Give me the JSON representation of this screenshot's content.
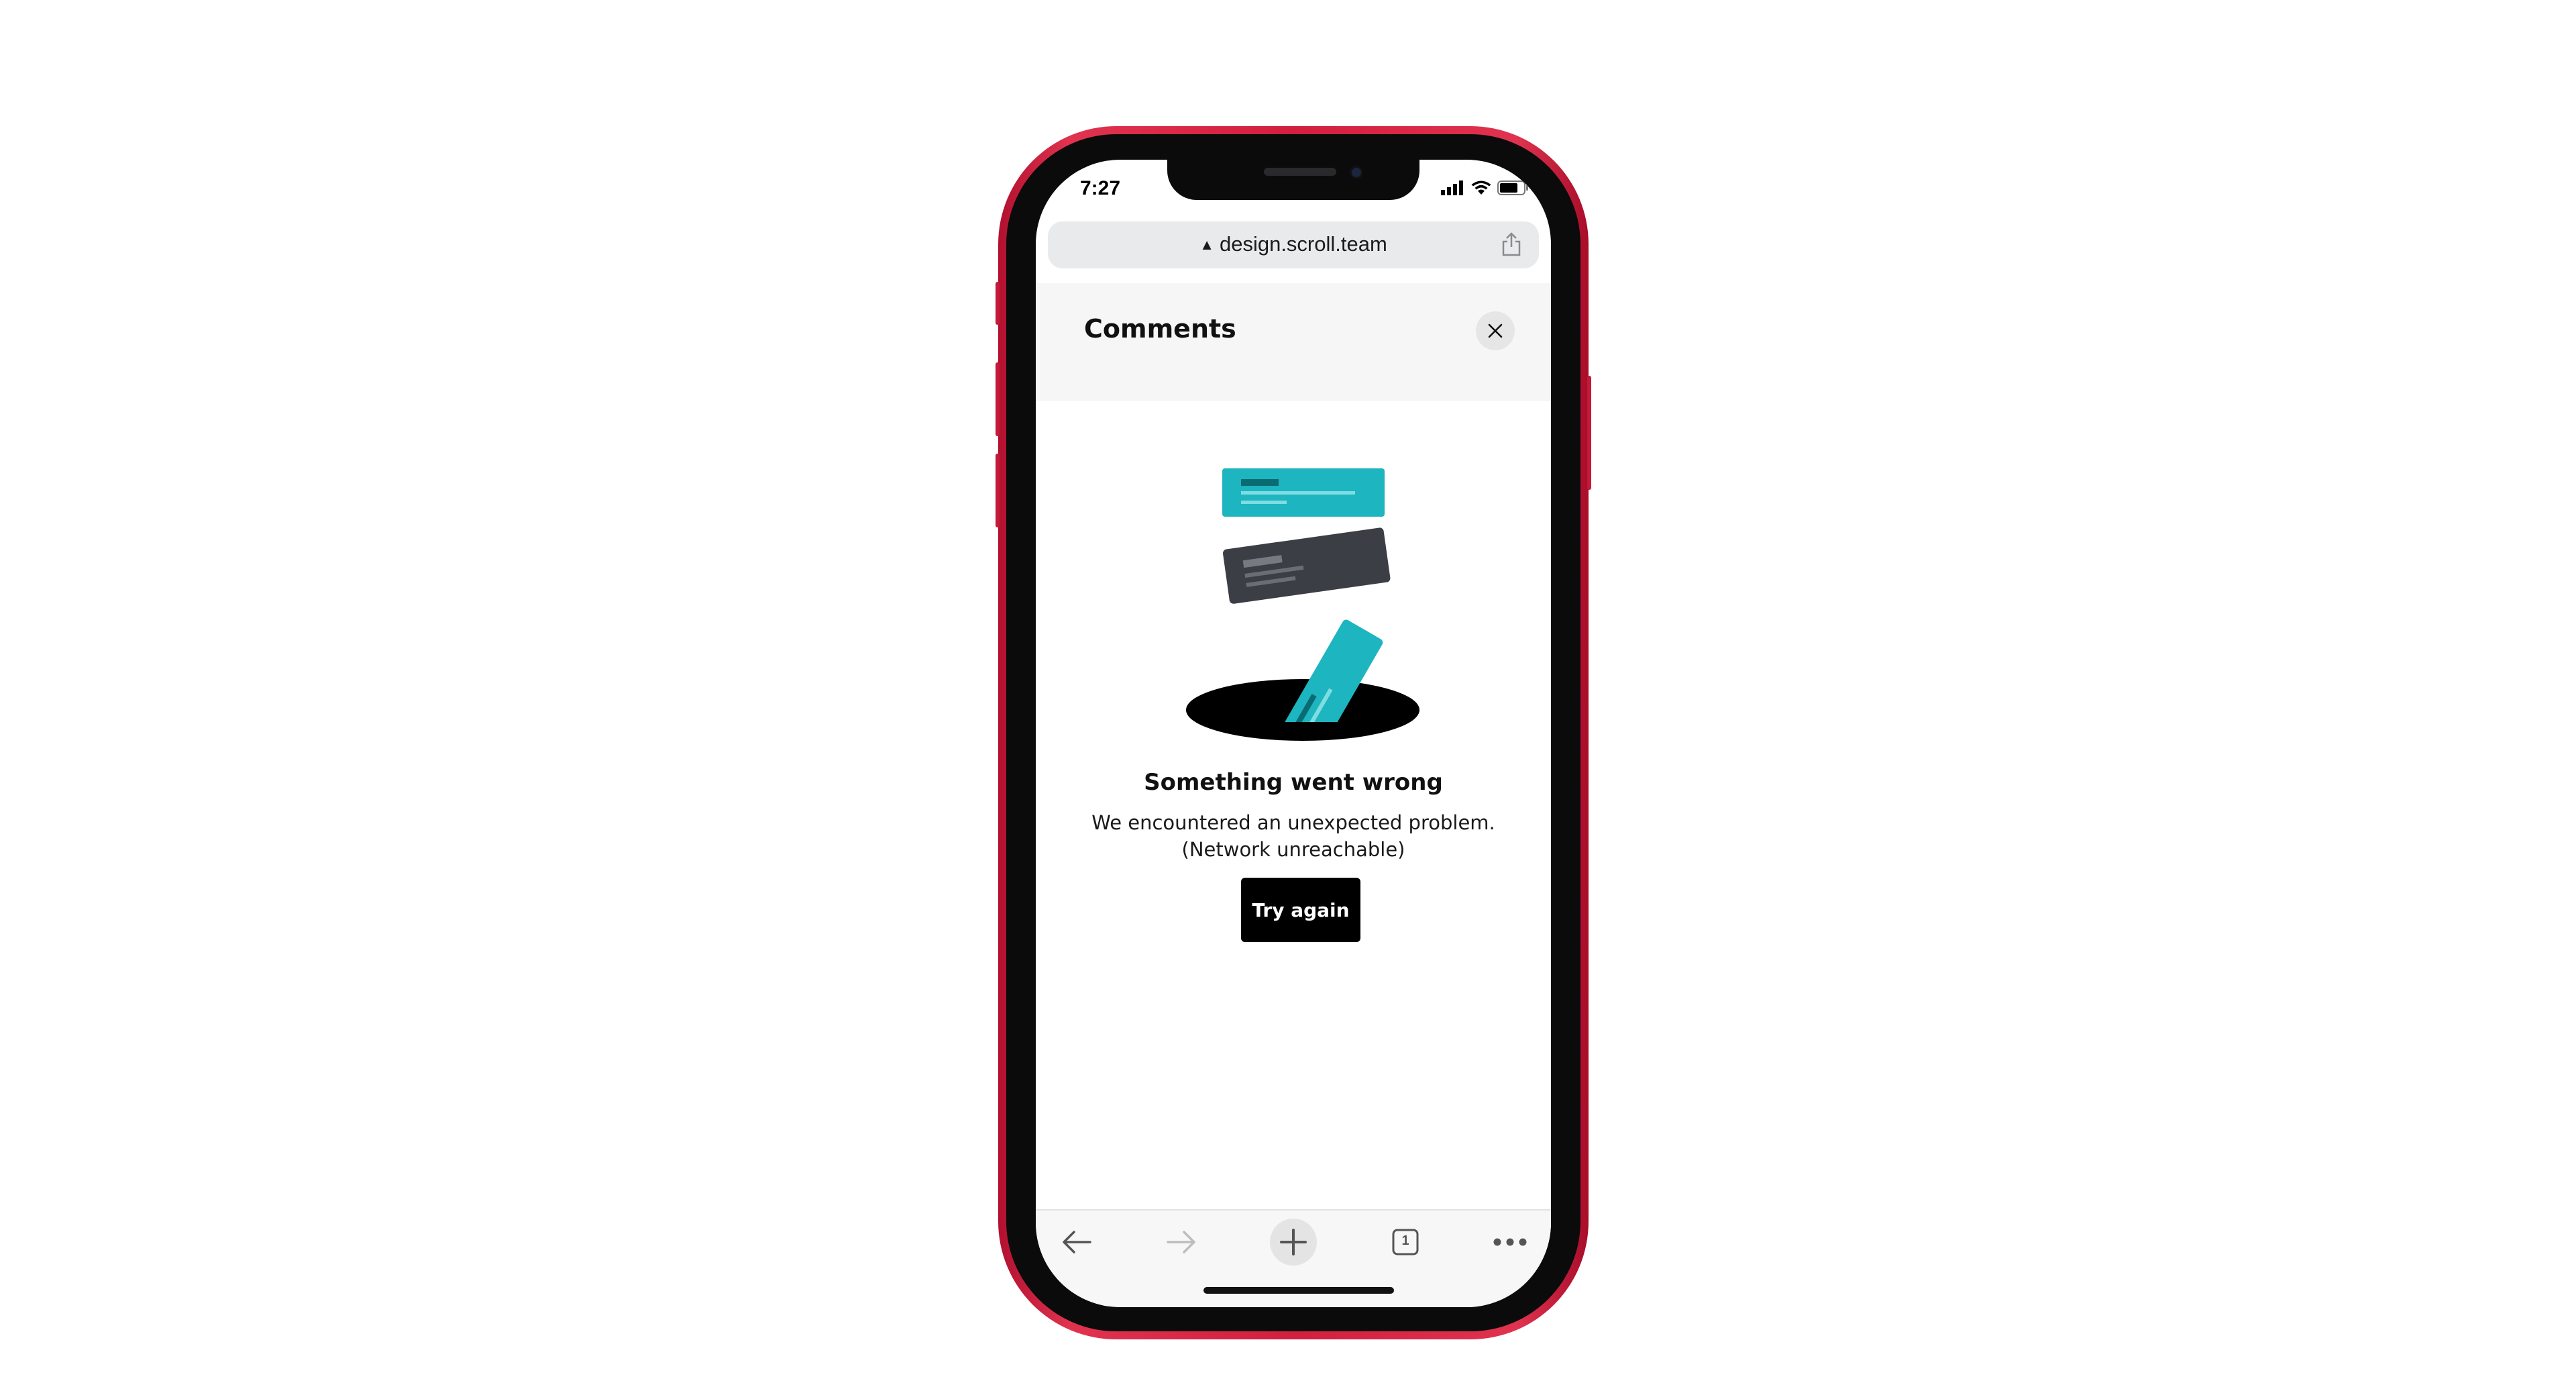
{
  "status_bar": {
    "time": "7:27"
  },
  "browser": {
    "url": "design.scroll.team",
    "lock_glyph": "▲"
  },
  "panel": {
    "title": "Comments",
    "close_icon": "close-icon"
  },
  "error": {
    "title": "Something went wrong",
    "message_line1": "We encountered an unexpected problem.",
    "message_line2": "(Network unreachable)",
    "retry_label": "Try again"
  },
  "toolbar": {
    "tabs_count": "1",
    "items": [
      "back-arrow-icon",
      "forward-arrow-icon",
      "new-tab-plus-icon",
      "tabs-icon",
      "more-icon"
    ]
  },
  "colors": {
    "frame": "#d21f3e",
    "accent_teal": "#1db5bf",
    "card_dark": "#3b3e44",
    "button": "#000000"
  }
}
